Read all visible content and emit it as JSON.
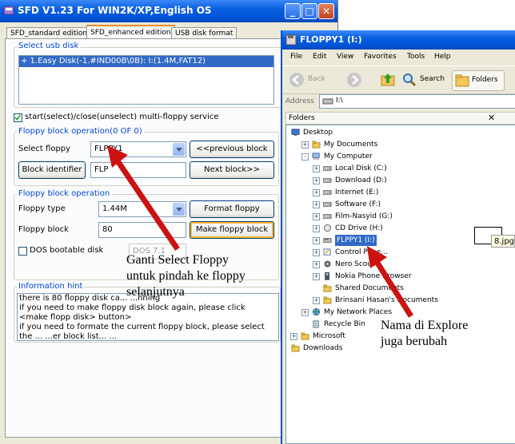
{
  "sfd": {
    "title": "SFD V1.23 For WIN2K/XP,English OS",
    "tabs": [
      "SFD_standard edition",
      "SFD_enhanced edition",
      "USB disk format"
    ],
    "select_usb_label": "Select usb disk",
    "usb_item": "+ 1.Easy Disk(-1.#IND00B\\0B): I:(1.4M,FAT12)",
    "multi_floppy_label": "start(select)/close(unselect) multi-floppy service",
    "block_op_label": "Floppy block operation(0 OF 0)",
    "select_floppy_label": "Select floppy",
    "select_floppy_value": "FLPPY1",
    "prev_block": "<<previous block",
    "block_identifier": "Block identifier",
    "identifier_value": "FLP",
    "next_block": "Next block>>",
    "block_op2_label": "Floppy block operation",
    "floppy_type_label": "Floppy type",
    "floppy_type_value": "1.44M",
    "format_floppy": "Format floppy",
    "floppy_block_label": "Floppy block",
    "floppy_block_value": "80",
    "make_block": "Make floppy block",
    "dos_bootable": "DOS bootable disk",
    "dos_combo": "DOS 7.1",
    "info_label": "Information hint",
    "info_lines": [
      "there is 80 floppy disk ca... ...nning",
      "if you need to make floppy disk block again, please click",
      "<make flopp disk> button>",
      "if you need to formate the current floppy block, please select",
      "the ... ...er block list... ..."
    ]
  },
  "explorer": {
    "title": "FLOPPY1 (I:)",
    "menu": [
      "File",
      "Edit",
      "View",
      "Favorites",
      "Tools",
      "Help"
    ],
    "back": "Back",
    "search": "Search",
    "folders_btn": "Folders",
    "address_label": "Address",
    "address_value": "I:\\",
    "folders_pane": "Folders",
    "tree": [
      {
        "label": "Desktop",
        "level": 0,
        "toggle": "",
        "icon": "desktop"
      },
      {
        "label": "My Documents",
        "level": 1,
        "toggle": "+",
        "icon": "folder"
      },
      {
        "label": "My Computer",
        "level": 1,
        "toggle": "-",
        "icon": "computer"
      },
      {
        "label": "Local Disk (C:)",
        "level": 2,
        "toggle": "+",
        "icon": "drive"
      },
      {
        "label": "Download (D:)",
        "level": 2,
        "toggle": "+",
        "icon": "drive"
      },
      {
        "label": "Internet (E:)",
        "level": 2,
        "toggle": "+",
        "icon": "drive"
      },
      {
        "label": "Software (F:)",
        "level": 2,
        "toggle": "+",
        "icon": "drive"
      },
      {
        "label": "Film-Nasyid (G:)",
        "level": 2,
        "toggle": "+",
        "icon": "drive"
      },
      {
        "label": "CD Drive (H:)",
        "level": 2,
        "toggle": "+",
        "icon": "cd"
      },
      {
        "label": "FLPPY1 (I:)",
        "level": 2,
        "toggle": "+",
        "icon": "floppy",
        "selected": true
      },
      {
        "label": "Control Pane...",
        "level": 2,
        "toggle": "+",
        "icon": "control"
      },
      {
        "label": "Nero Scout",
        "level": 2,
        "toggle": "+",
        "icon": "nero"
      },
      {
        "label": "Nokia Phone Browser",
        "level": 2,
        "toggle": "+",
        "icon": "phone"
      },
      {
        "label": "Shared Documents",
        "level": 2,
        "toggle": "",
        "icon": "folder"
      },
      {
        "label": "Brinsani Hasan's Documents",
        "level": 2,
        "toggle": "+",
        "icon": "folder"
      },
      {
        "label": "My Network Places",
        "level": 1,
        "toggle": "+",
        "icon": "network"
      },
      {
        "label": "Recycle Bin",
        "level": 1,
        "toggle": "",
        "icon": "recycle"
      },
      {
        "label": "Microsoft",
        "level": 0,
        "toggle": "+",
        "icon": "folder"
      },
      {
        "label": "Downloads",
        "level": 0,
        "toggle": "",
        "icon": "folder"
      }
    ],
    "file_label": "8.jpg"
  },
  "annotations": {
    "note1": [
      "Ganti Select Floppy",
      "untuk pindah ke floppy",
      "selanjutnya"
    ],
    "note2": [
      "Nama di Explore",
      "juga berubah"
    ]
  },
  "colors": {
    "xp_blue": "#0a5fe0",
    "arrow_red": "#cc1111",
    "selection": "#316ac5"
  }
}
